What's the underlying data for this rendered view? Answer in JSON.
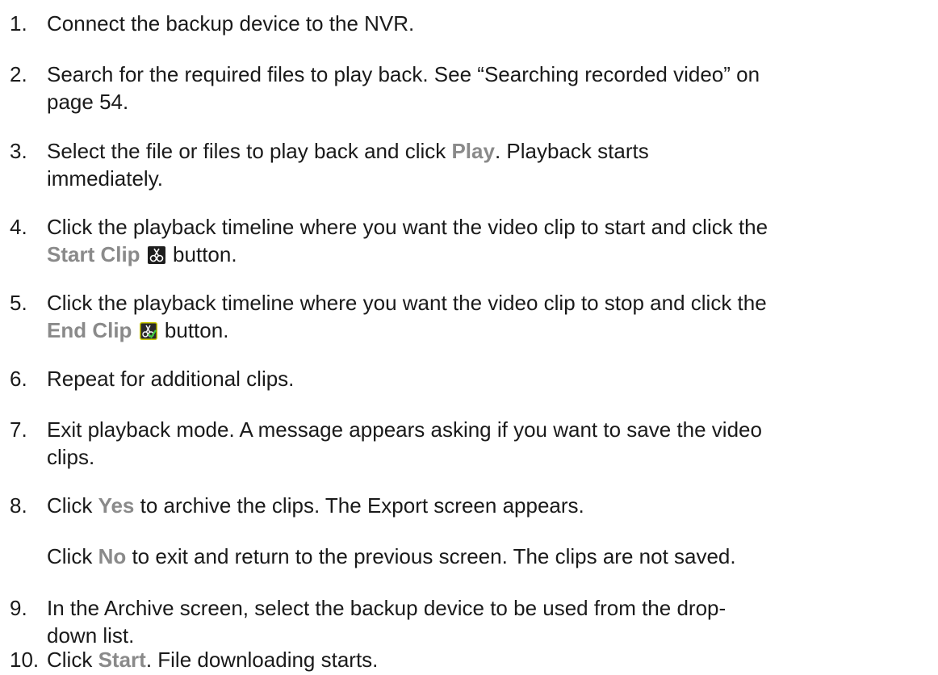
{
  "steps": [
    {
      "number": "1.",
      "lines": [
        "Connect the backup device to the NVR."
      ]
    },
    {
      "number": "2.",
      "lines": [
        "Search for the required files to play back. See “Searching recorded video” on",
        "page 54."
      ]
    },
    {
      "number": "3.",
      "line1_before": "Select the file or files to play back and click ",
      "line1_gui": "Play",
      "line1_after": ". Playback starts",
      "line2": "immediately."
    },
    {
      "number": "4.",
      "line1": "Click the playback timeline where you want the video clip to start and click the",
      "line2_gui": "Start Clip",
      "line2_after": "button.",
      "icon": "scissors-icon"
    },
    {
      "number": "5.",
      "line1": "Click the playback timeline where you want the video clip to stop and click the",
      "line2_gui": "End Clip",
      "line2_after": "button.",
      "icon": "scissors-check-icon"
    },
    {
      "number": "6.",
      "lines": [
        "Repeat for additional clips."
      ]
    },
    {
      "number": "7.",
      "lines": [
        "Exit playback mode. A message appears asking if you want to save the video",
        "clips."
      ]
    },
    {
      "number": "8.",
      "line1_before": "Click ",
      "line1_gui": "Yes",
      "line1_after": " to archive the clips. The Export screen appears."
    },
    {
      "note_before": "Click ",
      "note_gui": "No",
      "note_after": " to exit and return to the previous screen. The clips are not saved."
    },
    {
      "number": "9.",
      "lines": [
        "In the Archive screen, select the backup device to be used from the drop-",
        "down list."
      ]
    },
    {
      "number": "10.",
      "line1_before": "Click ",
      "line1_gui": "Start",
      "line1_after": ". File downloading starts."
    }
  ],
  "colors": {
    "text": "#1a1a1a",
    "gui_label": "#8a8a8a",
    "icon_bg": "#1e1e1e",
    "icon_border_end": "#c8c800"
  }
}
